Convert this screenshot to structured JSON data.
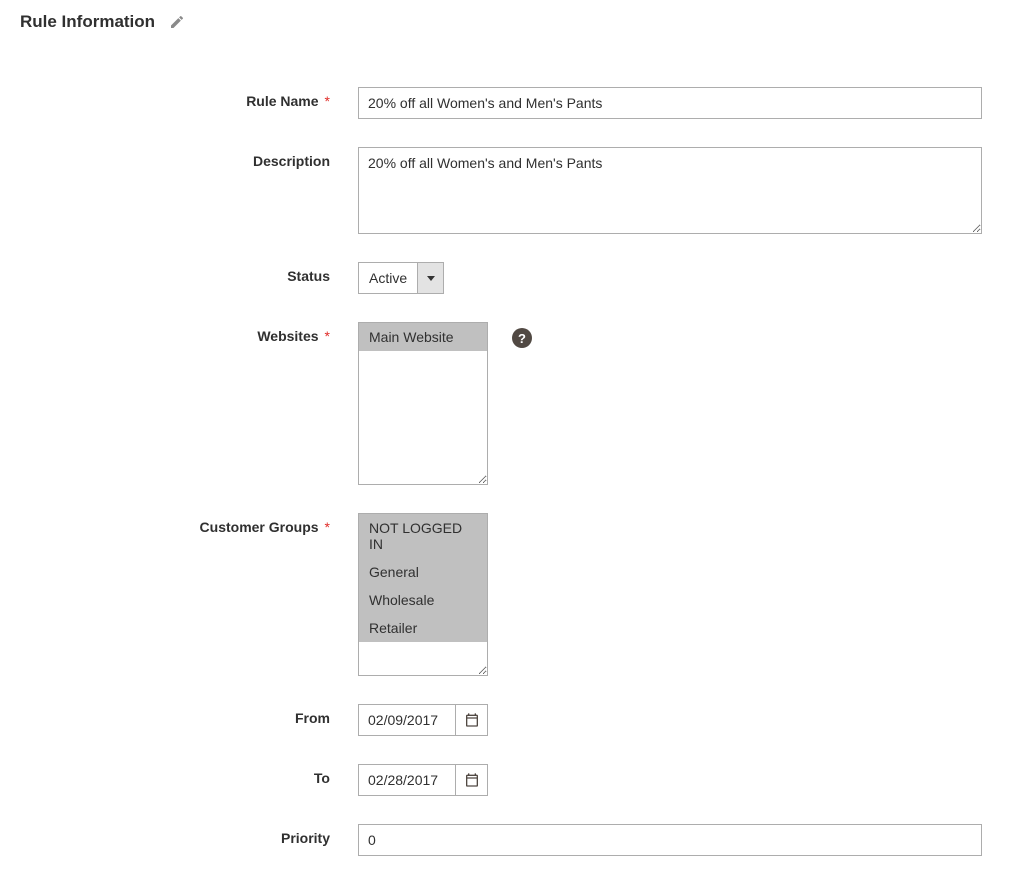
{
  "section": {
    "title": "Rule Information"
  },
  "labels": {
    "rule_name": "Rule Name",
    "description": "Description",
    "status": "Status",
    "websites": "Websites",
    "customer_groups": "Customer Groups",
    "from": "From",
    "to": "To",
    "priority": "Priority"
  },
  "fields": {
    "rule_name": "20% off all Women's and Men's Pants",
    "description": "20% off all Women's and Men's Pants",
    "status_value": "Active",
    "websites": [
      {
        "label": "Main Website",
        "selected": true
      }
    ],
    "customer_groups": [
      {
        "label": "NOT LOGGED IN",
        "selected": true
      },
      {
        "label": "General",
        "selected": true
      },
      {
        "label": "Wholesale",
        "selected": true
      },
      {
        "label": "Retailer",
        "selected": true
      }
    ],
    "from": "02/09/2017",
    "to": "02/28/2017",
    "priority": "0"
  }
}
